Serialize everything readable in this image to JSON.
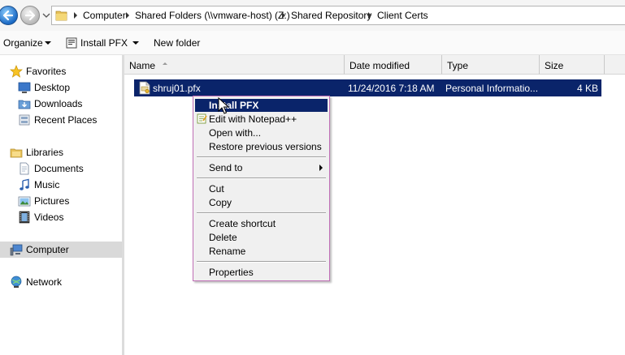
{
  "address": {
    "crumbs": [
      "Computer",
      "Shared Folders (\\\\vmware-host) (Z:)",
      "Shared Repository",
      "Client Certs"
    ]
  },
  "toolbar": {
    "organize_label": "Organize",
    "install_label": "Install PFX",
    "new_folder_label": "New folder"
  },
  "nav": {
    "favorites": "Favorites",
    "desktop": "Desktop",
    "downloads": "Downloads",
    "recent_places": "Recent Places",
    "libraries": "Libraries",
    "documents": "Documents",
    "music": "Music",
    "pictures": "Pictures",
    "videos": "Videos",
    "computer": "Computer",
    "network": "Network",
    "selected": "Computer"
  },
  "columns": {
    "name": "Name",
    "date": "Date modified",
    "type": "Type",
    "size": "Size"
  },
  "files": [
    {
      "name": "shruj01.pfx",
      "date": "11/24/2016 7:18 AM",
      "type": "Personal Informatio...",
      "size": "4 KB",
      "selected": true
    }
  ],
  "context_menu": {
    "install": "Install PFX",
    "edit_npp": "Edit with Notepad++",
    "open_with": "Open with...",
    "restore": "Restore previous versions",
    "send_to": "Send to",
    "cut": "Cut",
    "copy": "Copy",
    "create_shortcut": "Create shortcut",
    "delete": "Delete",
    "rename": "Rename",
    "properties": "Properties",
    "highlighted": "Install PFX"
  },
  "colors": {
    "selection": "#0a246a",
    "menu_border": "#c06fb6",
    "menu_bg": "#f0f0f0"
  }
}
